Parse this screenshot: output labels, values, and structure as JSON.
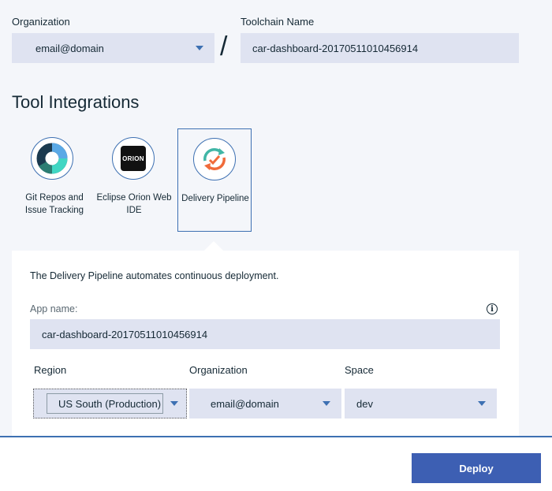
{
  "organization": {
    "label": "Organization",
    "value": "email@domain"
  },
  "separator": "/",
  "toolchain": {
    "label": "Toolchain Name",
    "value": "car-dashboard-20170511010456914"
  },
  "tool_integrations": {
    "title": "Tool Integrations",
    "tools": [
      {
        "label_line1": "Git Repos and",
        "label_line2": "Issue Tracking"
      },
      {
        "label_line1": "Eclipse Orion Web",
        "label_line2": "IDE",
        "icon_text": "ORION"
      },
      {
        "label_line1": "Delivery Pipeline",
        "label_line2": ""
      }
    ]
  },
  "pipeline": {
    "description": "The Delivery Pipeline automates continuous deployment.",
    "app_name_label": "App name:",
    "app_name_value": "car-dashboard-20170511010456914",
    "info_glyph": "i",
    "region": {
      "label": "Region",
      "value": "US South (Production)"
    },
    "organization": {
      "label": "Organization",
      "value": "email@domain"
    },
    "space": {
      "label": "Space",
      "value": "dev"
    }
  },
  "footer": {
    "deploy_label": "Deploy"
  },
  "colors": {
    "accent": "#3d70b2",
    "button": "#3d5fb3",
    "field_bg": "#dfe3f1",
    "page_bg": "#f4f6fa"
  }
}
